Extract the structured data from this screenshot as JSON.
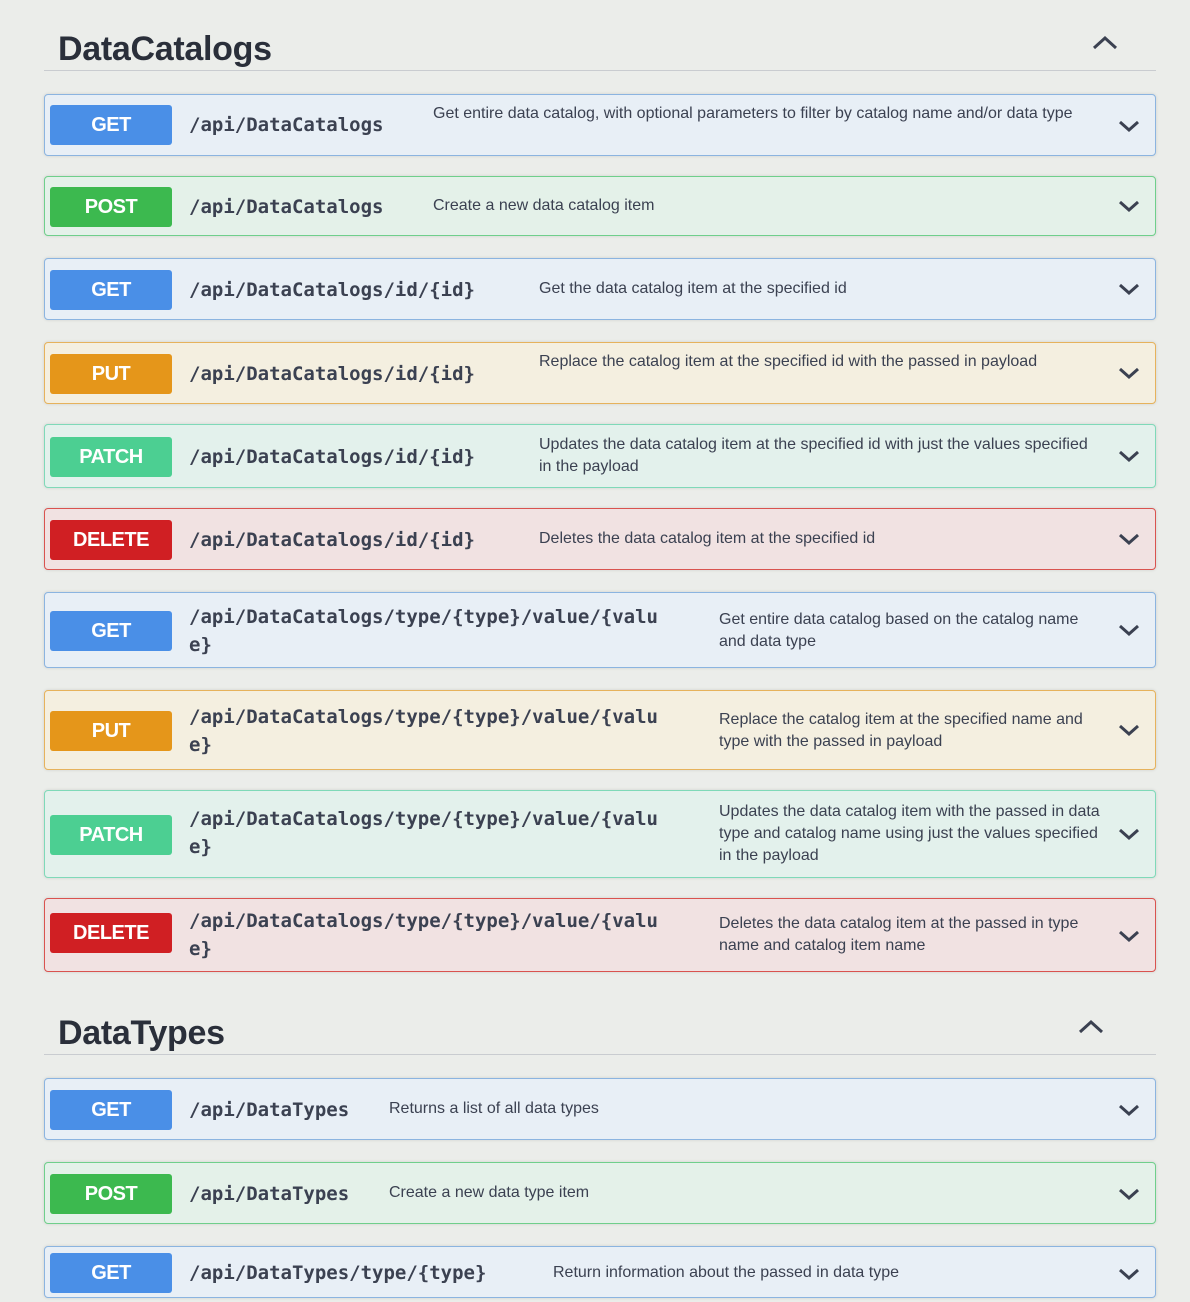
{
  "sections": [
    {
      "title": "DataCatalogs",
      "operations": [
        {
          "method": "GET",
          "path": "/api/DataCatalogs",
          "description": "Get entire data catalog, with optional parameters to filter by catalog name and/or data type"
        },
        {
          "method": "POST",
          "path": "/api/DataCatalogs",
          "description": "Create a new data catalog item"
        },
        {
          "method": "GET",
          "path": "/api/DataCatalogs/id/{id}",
          "description": "Get the data catalog item at the specified id"
        },
        {
          "method": "PUT",
          "path": "/api/DataCatalogs/id/{id}",
          "description": "Replace the catalog item at the specified id with the passed in payload"
        },
        {
          "method": "PATCH",
          "path": "/api/DataCatalogs/id/{id}",
          "description": "Updates the data catalog item at the specified id with just the values specified in the payload"
        },
        {
          "method": "DELETE",
          "path": "/api/DataCatalogs/id/{id}",
          "description": "Deletes the data catalog item at the specified id"
        },
        {
          "method": "GET",
          "path": "/api/DataCatalogs/type/{type}/value/{value}",
          "description": "Get entire data catalog based on the catalog name and data type"
        },
        {
          "method": "PUT",
          "path": "/api/DataCatalogs/type/{type}/value/{value}",
          "description": "Replace the catalog item at the specified name and type with the passed in payload"
        },
        {
          "method": "PATCH",
          "path": "/api/DataCatalogs/type/{type}/value/{value}",
          "description": "Updates the data catalog item with the passed in data type and catalog name using just the values specified in the payload"
        },
        {
          "method": "DELETE",
          "path": "/api/DataCatalogs/type/{type}/value/{value}",
          "description": "Deletes the data catalog item at the passed in type name and catalog item name"
        }
      ]
    },
    {
      "title": "DataTypes",
      "operations": [
        {
          "method": "GET",
          "path": "/api/DataTypes",
          "description": "Returns a list of all data types"
        },
        {
          "method": "POST",
          "path": "/api/DataTypes",
          "description": "Create a new data type item"
        },
        {
          "method": "GET",
          "path": "/api/DataTypes/type/{type}",
          "description": "Return information about the passed in data type"
        }
      ]
    }
  ],
  "icons": {
    "collapse": "chevron-up-icon",
    "expand": "chevron-down-icon"
  },
  "colors": {
    "get": "#4a8fe7",
    "post": "#3cb94f",
    "put": "#e5961a",
    "patch": "#4ccf92",
    "delete": "#d01f23"
  }
}
